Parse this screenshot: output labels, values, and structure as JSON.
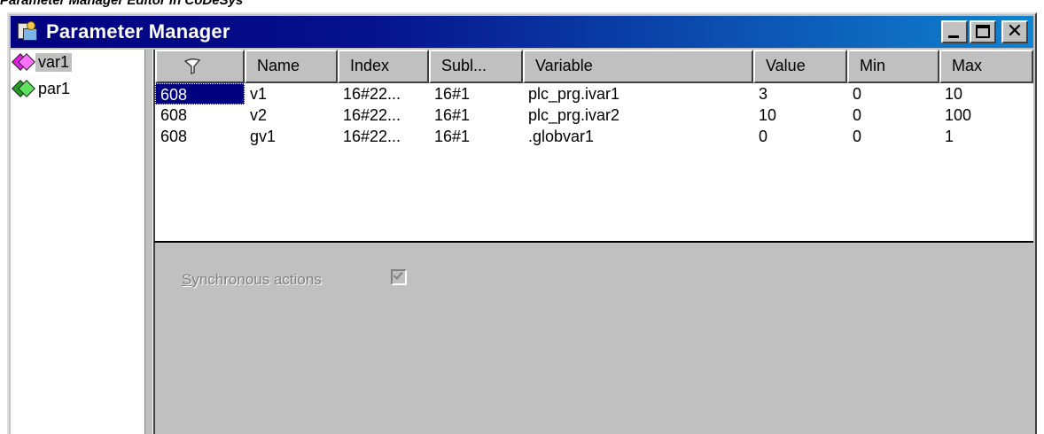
{
  "caption": "Parameter Manager Editor in CoDeSys",
  "window": {
    "title": "Parameter Manager",
    "buttons": {
      "minimize": "_",
      "maximize": "□",
      "close": "✕"
    }
  },
  "tree": {
    "items": [
      {
        "label": "var1",
        "icon": "cube-magenta-icon",
        "color": "#e020e0",
        "selected": true
      },
      {
        "label": "par1",
        "icon": "cube-green-icon",
        "color": "#20c020",
        "selected": false
      }
    ]
  },
  "table": {
    "filter_icon": "funnel-icon",
    "columns": [
      "",
      "Name",
      "Index",
      "Subl...",
      "Variable",
      "Value",
      "Min",
      "Max"
    ],
    "rows": [
      [
        "608",
        "v1",
        "16#22...",
        "16#1",
        "plc_prg.ivar1",
        "3",
        "0",
        "10"
      ],
      [
        "608",
        "v2",
        "16#22...",
        "16#1",
        "plc_prg.ivar2",
        "10",
        "0",
        "100"
      ],
      [
        "608",
        "gv1",
        "16#22...",
        "16#1",
        ".globvar1",
        "0",
        "0",
        "1"
      ]
    ],
    "selected_cell": {
      "row": 0,
      "col": 0
    }
  },
  "sync": {
    "label_mnemonic": "S",
    "label_rest": "ynchronous actions",
    "checked": true
  },
  "colors": {
    "title_start": "#000080",
    "title_end": "#1084d0",
    "selection": "#000080",
    "face": "#c0c0c0"
  }
}
